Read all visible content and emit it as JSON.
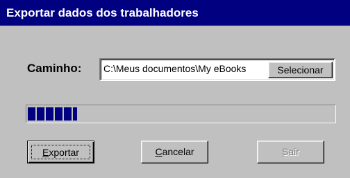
{
  "window": {
    "title": "Exportar dados dos trabalhadores"
  },
  "path": {
    "label": "Caminho:",
    "value": "C:\\Meus documentos\\My eBooks",
    "select_button": "Selecionar"
  },
  "progress": {
    "value_fraction": 0.16
  },
  "buttons": {
    "export": {
      "mnemonic": "E",
      "rest": "xportar",
      "enabled": true
    },
    "cancel": {
      "mnemonic": "C",
      "rest": "ancelar",
      "enabled": true
    },
    "exit": {
      "mnemonic": "S",
      "rest": "air",
      "enabled": false
    }
  },
  "colors": {
    "titlebar": "#000080",
    "window_face": "#c0c0c0",
    "progress_block": "#000080",
    "disabled_text": "#808080"
  }
}
